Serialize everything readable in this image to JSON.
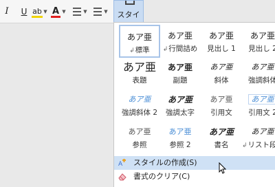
{
  "ribbon": {
    "italic": "I",
    "underline": "U",
    "strikethrough_abc": "ab",
    "font_color_letter": "A",
    "highlight_color": "#f0d400",
    "font_color": "#e02020"
  },
  "styles_button": {
    "label": "スタイル"
  },
  "gallery": {
    "rows": [
      [
        {
          "sample": "あア亜",
          "name": "標準",
          "style": "s-normal",
          "mark": "↲"
        },
        {
          "sample": "あア亜",
          "name": "行間詰め",
          "style": "s-normal",
          "mark": "↲"
        },
        {
          "sample": "あア亜",
          "name": "見出し 1",
          "style": "s-normal"
        },
        {
          "sample": "あア亜",
          "name": "見出し 2",
          "style": "s-normal"
        }
      ],
      [
        {
          "sample": "あア亜",
          "name": "表題",
          "style": "s-big"
        },
        {
          "sample": "あア亜",
          "name": "副題",
          "style": "s-bold"
        },
        {
          "sample": "あア亜",
          "name": "斜体",
          "style": "s-it"
        },
        {
          "sample": "あア亜",
          "name": "強調斜体",
          "style": "s-it"
        }
      ],
      [
        {
          "sample": "あア亜",
          "name": "強調斜体 2",
          "style": "s-it-blue"
        },
        {
          "sample": "あア亜",
          "name": "強調太字",
          "style": "s-it-bold"
        },
        {
          "sample": "あア亜",
          "name": "引用文",
          "style": "s-gray"
        },
        {
          "sample": "あア亜",
          "name": "引用文 2",
          "style": "s-it-blue s-boxed"
        }
      ],
      [
        {
          "sample": "あア亜",
          "name": "参照",
          "style": "s-gray"
        },
        {
          "sample": "あア亜",
          "name": "参照 2",
          "style": "s-blue"
        },
        {
          "sample": "あア亜",
          "name": "書名",
          "style": "s-it-bold"
        },
        {
          "sample": "あア亜",
          "name": "リスト段落",
          "style": "s-it",
          "mark": "↲"
        }
      ]
    ]
  },
  "menu": {
    "create_style": "スタイルの作成(S)",
    "clear_formatting": "書式のクリア(C)"
  }
}
